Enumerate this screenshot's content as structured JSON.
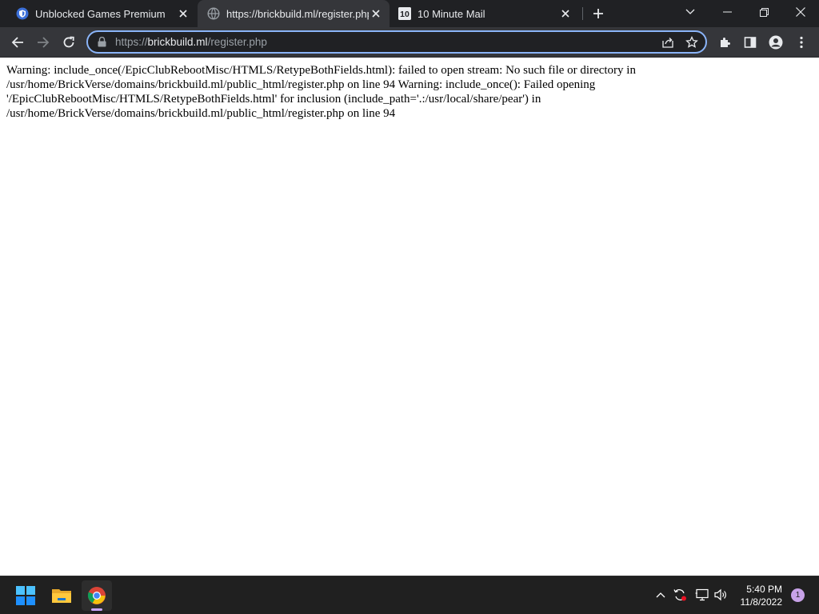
{
  "browser": {
    "tabs": [
      {
        "title": "Unblocked Games Premium",
        "active": false,
        "icon": "shield-favicon-icon"
      },
      {
        "title": "https://brickbuild.ml/register.php",
        "active": true,
        "icon": "globe-icon"
      },
      {
        "title": "10 Minute Mail",
        "active": false,
        "icon": "tenminutemail-favicon-icon"
      }
    ],
    "tab_close_glyph": "✕",
    "new_tab_glyph": "+",
    "omnibox": {
      "scheme": "https://",
      "host": "brickbuild.ml",
      "path": "/register.php"
    },
    "accent_color": "#8ab4f8"
  },
  "page": {
    "warning_text": "Warning: include_once(/EpicClubRebootMisc/HTMLS/RetypeBothFields.html): failed to open stream: No such file or directory in /usr/home/BrickVerse/domains/brickbuild.ml/public_html/register.php on line 94 Warning: include_once(): Failed opening '/EpicClubRebootMisc/HTMLS/RetypeBothFields.html' for inclusion (include_path='.:/usr/local/share/pear') in /usr/home/BrickVerse/domains/brickbuild.ml/public_html/register.php on line 94"
  },
  "taskbar": {
    "time": "5:40 PM",
    "date": "11/8/2022",
    "notification_count": "1"
  }
}
